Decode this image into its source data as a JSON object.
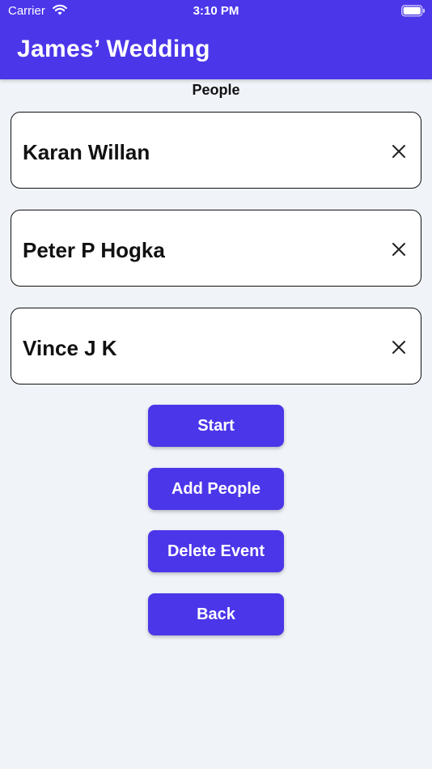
{
  "status_bar": {
    "carrier": "Carrier",
    "time": "3:10 PM",
    "wifi_icon": "wifi-icon",
    "battery_icon": "battery-icon"
  },
  "header": {
    "title": "James’ Wedding",
    "background_color": "#4b36ea"
  },
  "section_label": "People",
  "people": [
    {
      "name": "Karan Willan",
      "remove_icon": "close-icon"
    },
    {
      "name": "Peter P Hogka",
      "remove_icon": "close-icon"
    },
    {
      "name": "Vince J K",
      "remove_icon": "close-icon"
    }
  ],
  "actions": {
    "start_label": "Start",
    "add_people_label": "Add People",
    "delete_event_label": "Delete Event",
    "back_label": "Back",
    "button_color": "#4b36ea"
  }
}
